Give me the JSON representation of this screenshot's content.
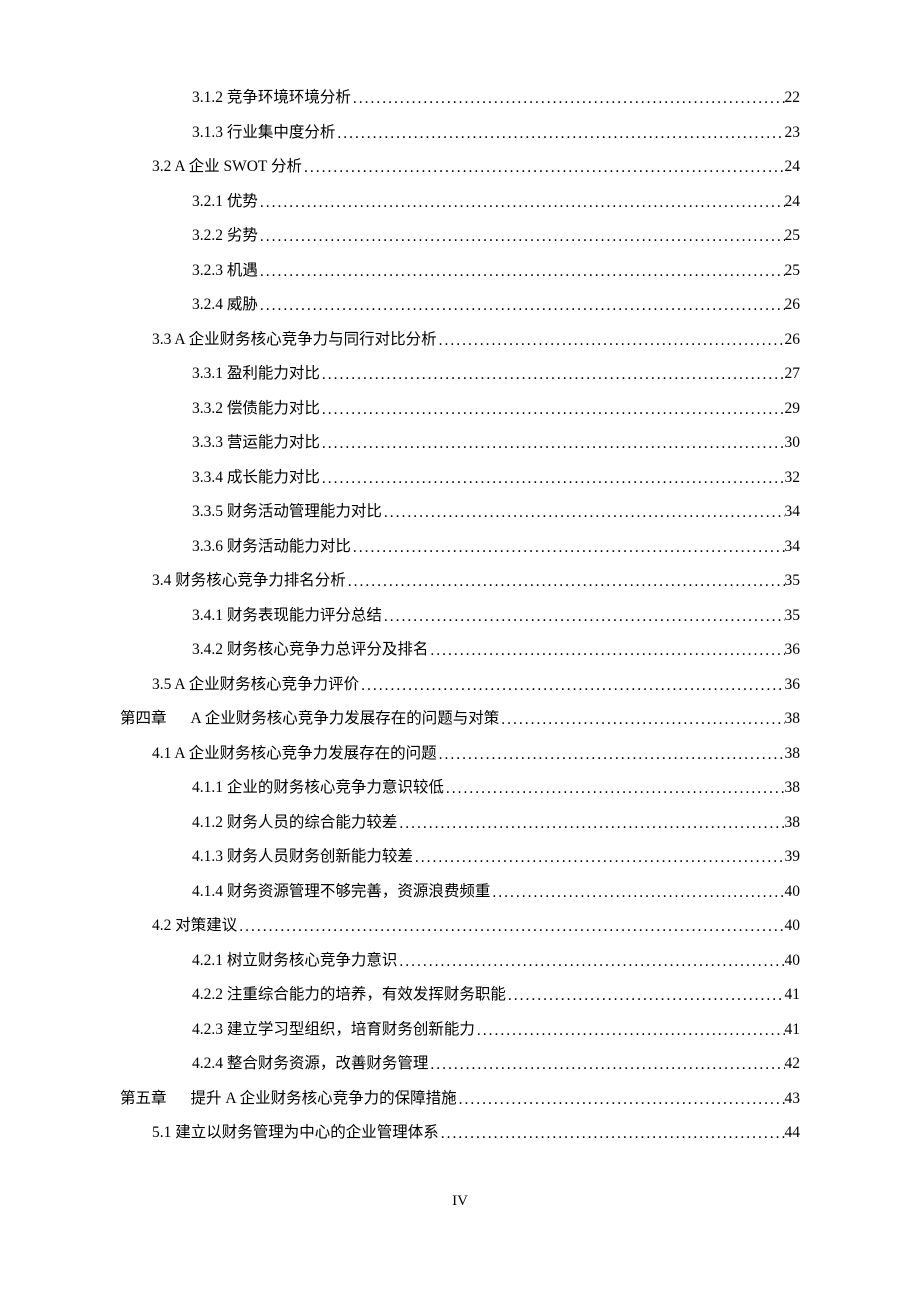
{
  "toc": [
    {
      "indent": 2,
      "label": "3.1.2  竞争环境环境分析",
      "page": "22"
    },
    {
      "indent": 2,
      "label": "3.1.3  行业集中度分析",
      "page": "23"
    },
    {
      "indent": 1,
      "label": "3.2 A 企业 SWOT 分析",
      "page": "24"
    },
    {
      "indent": 2,
      "label": "3.2.1  优势",
      "page": "24"
    },
    {
      "indent": 2,
      "label": "3.2.2  劣势",
      "page": "25"
    },
    {
      "indent": 2,
      "label": "3.2.3  机遇",
      "page": "25"
    },
    {
      "indent": 2,
      "label": "3.2.4 威胁",
      "page": "26"
    },
    {
      "indent": 1,
      "label": "3.3 A 企业财务核心竞争力与同行对比分析",
      "page": "26"
    },
    {
      "indent": 2,
      "label": "3.3.1  盈利能力对比",
      "page": "27"
    },
    {
      "indent": 2,
      "label": "3.3.2  偿债能力对比",
      "page": "29"
    },
    {
      "indent": 2,
      "label": "3.3.3  营运能力对比",
      "page": "30"
    },
    {
      "indent": 2,
      "label": "3.3.4 成长能力对比",
      "page": "32"
    },
    {
      "indent": 2,
      "label": "3.3.5  财务活动管理能力对比",
      "page": "34"
    },
    {
      "indent": 2,
      "label": "3.3.6  财务活动能力对比",
      "page": "34"
    },
    {
      "indent": 1,
      "label": "3.4  财务核心竞争力排名分析",
      "page": "35"
    },
    {
      "indent": 2,
      "label": "3.4.1 财务表现能力评分总结",
      "page": "35"
    },
    {
      "indent": 2,
      "label": "3.4.2  财务核心竞争力总评分及排名",
      "page": "36"
    },
    {
      "indent": 1,
      "label": "3.5 A 企业财务核心竞争力评价",
      "page": "36"
    },
    {
      "indent": 0,
      "prefix": "第四章",
      "label": "A 企业财务核心竞争力发展存在的问题与对策",
      "page": "38"
    },
    {
      "indent": 1,
      "label": "4.1 A 企业财务核心竞争力发展存在的问题",
      "page": "38"
    },
    {
      "indent": 2,
      "label": "4.1.1 企业的财务核心竞争力意识较低",
      "page": "38"
    },
    {
      "indent": 2,
      "label": "4.1.2  财务人员的综合能力较差",
      "page": "38"
    },
    {
      "indent": 2,
      "label": "4.1.3  财务人员财务创新能力较差",
      "page": "39"
    },
    {
      "indent": 2,
      "label": "4.1.4  财务资源管理不够完善，资源浪费频重",
      "page": "40"
    },
    {
      "indent": 1,
      "label": "4.2  对策建议",
      "page": "40"
    },
    {
      "indent": 2,
      "label": "4.2.1  树立财务核心竞争力意识",
      "page": "40"
    },
    {
      "indent": 2,
      "label": "4.2.2  注重综合能力的培养，有效发挥财务职能",
      "page": "41"
    },
    {
      "indent": 2,
      "label": "4.2.3  建立学习型组织，培育财务创新能力",
      "page": "41"
    },
    {
      "indent": 2,
      "label": "4.2.4  整合财务资源，改善财务管理",
      "page": "42"
    },
    {
      "indent": 0,
      "prefix": "第五章",
      "label": "提升 A 企业财务核心竞争力的保障措施",
      "page": "43"
    },
    {
      "indent": 1,
      "label": "5.1  建立以财务管理为中心的企业管理体系",
      "page": "44"
    }
  ],
  "page_number": "IV"
}
